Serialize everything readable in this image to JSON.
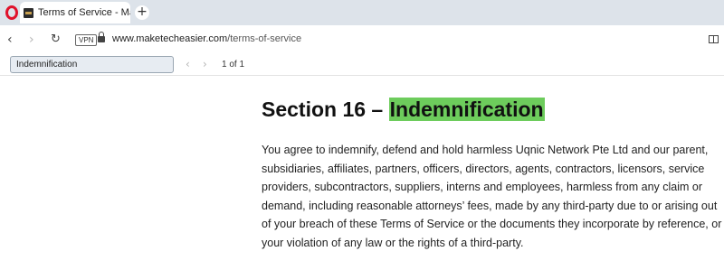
{
  "browser": {
    "tab": {
      "title": "Terms of Service - Make T"
    },
    "address": {
      "vpn_label": "VPN",
      "url_host": "www.maketecheasier.com",
      "url_path": "/terms-of-service"
    }
  },
  "find": {
    "query": "Indemnification",
    "count": "1 of 1"
  },
  "page": {
    "heading_prefix": "Section 16 – ",
    "heading_highlight": "Indemnification",
    "paragraph": "You agree to indemnify, defend and hold harmless Uqnic Network Pte Ltd and our parent, subsidiaries, affiliates, partners, officers, directors, agents, contractors, licensors, service providers, subcontractors, suppliers, interns and employees, harmless from any claim or demand, including reasonable attorneys’ fees, made by any third-party due to or arising out of your breach of these Terms of Service or the documents they incorporate by reference, or your violation of any law or the rights of a third-party."
  },
  "colors": {
    "highlight": "#6dcc5c",
    "tabstrip": "#dde3ea",
    "opera_red": "#e0112b"
  }
}
